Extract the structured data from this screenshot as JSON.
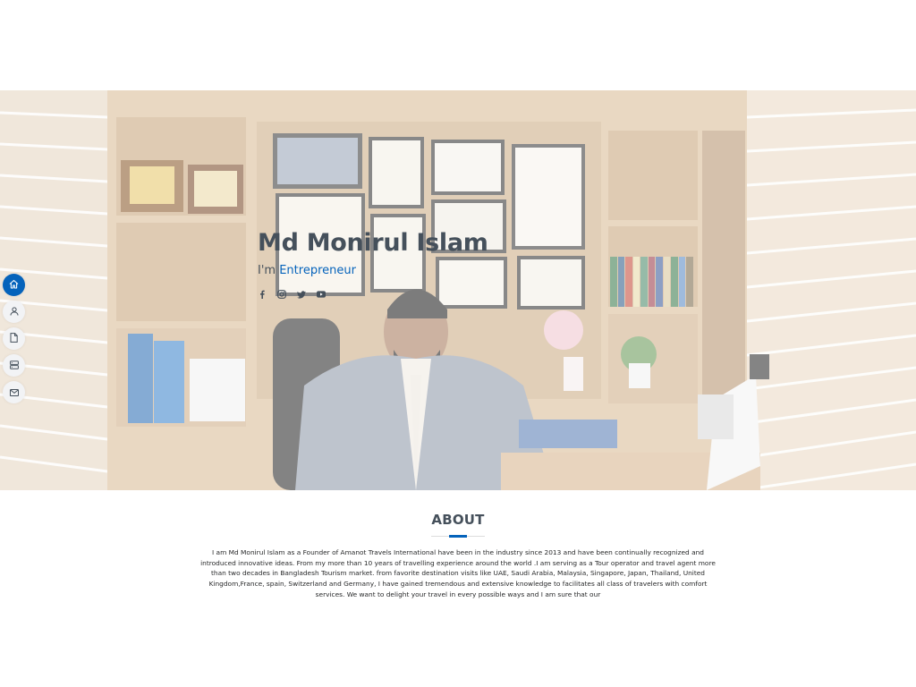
{
  "hero": {
    "name": "Md Monirul Islam",
    "subtitle_prefix": "I'm ",
    "subtitle_role": "Entrepreneur",
    "socials": [
      "facebook-icon",
      "instagram-icon",
      "twitter-icon",
      "youtube-icon"
    ]
  },
  "sidenav": {
    "items": [
      "home-icon",
      "user-icon",
      "file-icon",
      "server-icon",
      "envelope-icon"
    ],
    "active": "home-icon"
  },
  "about": {
    "title": "ABOUT",
    "text": "I am Md Monirul Islam as a Founder of Amanot Travels International have been in the industry since 2013 and have been continually recognized and introduced innovative ideas. From my more than 10 years of travelling experience around the world .I am serving as a Tour operator and travel agent more than two decades in Bangladesh Tourism market. from favorite destination visits like UAE, Saudi Arabia, Malaysia, Singapore, Japan, Thailand, United Kingdom,France, spain, Switzerland and Germany, I have gained tremendous and extensive knowledge to facilitates all class of travelers with comfort services. We want to delight your travel in every possible ways and I am sure that our"
  },
  "colors": {
    "accent": "#0563bb",
    "heading": "#45505b",
    "text": "#272829"
  }
}
